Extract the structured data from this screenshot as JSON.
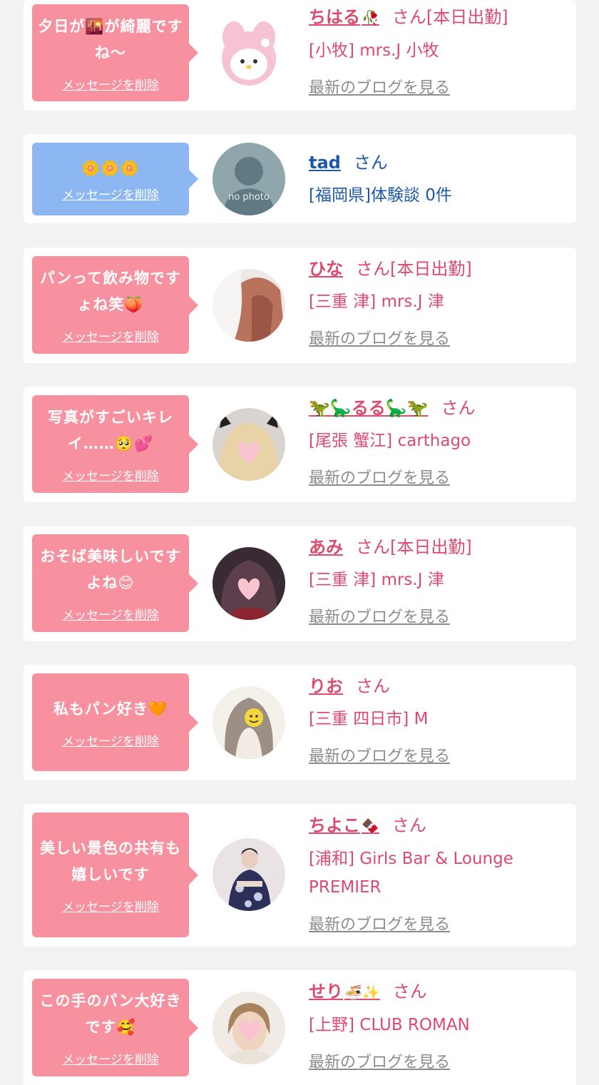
{
  "theme": {
    "pink_bubble": "#f7919f",
    "blue_bubble": "#8db7f2",
    "pink_text": "#de4a6e",
    "blue_text": "#1c5aa8",
    "link_gray": "#8c8c8c"
  },
  "entries": [
    {
      "message": "夕日が🌇が綺麗ですね〜",
      "delete_label": "メッセージを削除",
      "name": "ちはる",
      "name_icon": "🥀",
      "san": "さん[本日出勤]",
      "shop": "[小牧] mrs.J 小牧",
      "blog_label": "最新のブログを見る",
      "avatar_icon": "character-plush-icon"
    },
    {
      "message": "🌼🌼🌼",
      "delete_label": "メッセージを削除",
      "name": "tad",
      "name_icon": "",
      "san": "さん",
      "shop": "[福岡県]体験談 0件",
      "blog_label": "",
      "avatar_label": "no photo",
      "avatar_icon": "no-photo-silhouette-icon"
    },
    {
      "message": "パンって飲み物ですょね笑🍑",
      "delete_label": "メッセージを削除",
      "name": "ひな",
      "name_icon": "",
      "san": "さん[本日出勤]",
      "shop": "[三重 津] mrs.J 津",
      "blog_label": "最新のブログを見る",
      "avatar_icon": "user-photo-icon"
    },
    {
      "message": "写真がすごいキレイ……🥺💕",
      "delete_label": "メッセージを削除",
      "name": "🦖🦕るる🦕🦖",
      "name_icon": "",
      "san": "さん",
      "shop": "[尾張 蟹江] carthago",
      "blog_label": "最新のブログを見る",
      "avatar_icon": "heart-face-photo-icon"
    },
    {
      "message": "おそば美味しいですよね😊",
      "delete_label": "メッセージを削除",
      "name": "あみ",
      "name_icon": "",
      "san": "さん[本日出勤]",
      "shop": "[三重 津] mrs.J 津",
      "blog_label": "最新のブログを見る",
      "avatar_icon": "heart-face-photo-icon"
    },
    {
      "message": "私もパン好き🧡",
      "delete_label": "メッセージを削除",
      "name": "りお",
      "name_icon": "",
      "san": "さん",
      "shop": "[三重 四日市] M",
      "blog_label": "最新のブログを見る",
      "avatar_icon": "smiley-face-photo-icon"
    },
    {
      "message": "美しい景色の共有も嬉しいです",
      "delete_label": "メッセージを削除",
      "name": "ちよこ",
      "name_icon": "🍫",
      "san": "さん",
      "shop": "[浦和] Girls Bar & Lounge PREMIER",
      "blog_label": "最新のブログを見る",
      "avatar_icon": "kimono-photo-icon"
    },
    {
      "message": "この手のパン大好きです🥰",
      "delete_label": "メッセージを削除",
      "name": "せり",
      "name_icon": "🍜✨",
      "san": "さん",
      "shop": "[上野] CLUB ROMAN",
      "blog_label": "最新のブログを見る",
      "avatar_icon": "heart-face-photo-icon"
    }
  ]
}
